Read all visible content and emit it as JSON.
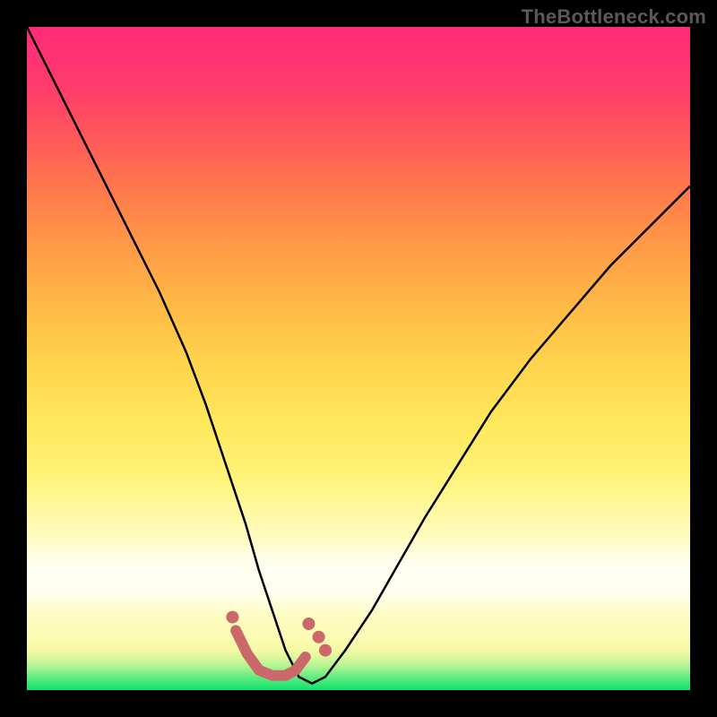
{
  "watermark": "TheBottleneck.com",
  "colors": {
    "marker": "#cb6869",
    "curve": "#000000",
    "frame": "#000000",
    "grad_top": "#ff2a7b",
    "grad_bottom": "#12e26b"
  },
  "chart_data": {
    "type": "line",
    "title": "",
    "xlabel": "",
    "ylabel": "",
    "xlim": [
      0,
      100
    ],
    "ylim": [
      0,
      100
    ],
    "grid": false,
    "legend": false,
    "series": [
      {
        "name": "bottleneck-curve",
        "x": [
          0,
          4,
          8,
          12,
          16,
          20,
          24,
          27,
          30,
          33,
          35,
          37,
          39,
          41,
          43,
          45,
          48,
          52,
          56,
          60,
          65,
          70,
          76,
          82,
          88,
          94,
          100
        ],
        "y": [
          100,
          92,
          84,
          76,
          68,
          60,
          51,
          43,
          34,
          25,
          18,
          12,
          6,
          2,
          1,
          2,
          6,
          12,
          19,
          26,
          34,
          42,
          50,
          57,
          64,
          70,
          76
        ]
      }
    ],
    "markers": [
      {
        "name": "marker-left-dot",
        "x": 31.0,
        "y": 11.0
      },
      {
        "name": "marker-right-dot1",
        "x": 42.5,
        "y": 10.0
      },
      {
        "name": "marker-right-dot2",
        "x": 44.0,
        "y": 8.0
      },
      {
        "name": "marker-right-dot3",
        "x": 45.0,
        "y": 6.0
      }
    ],
    "marker_path": {
      "name": "trough-markers",
      "x": [
        31.5,
        33.2,
        35.0,
        37.0,
        39.0,
        40.5,
        42.0
      ],
      "y": [
        9.0,
        5.5,
        3.0,
        2.2,
        2.2,
        3.0,
        5.0
      ]
    }
  }
}
